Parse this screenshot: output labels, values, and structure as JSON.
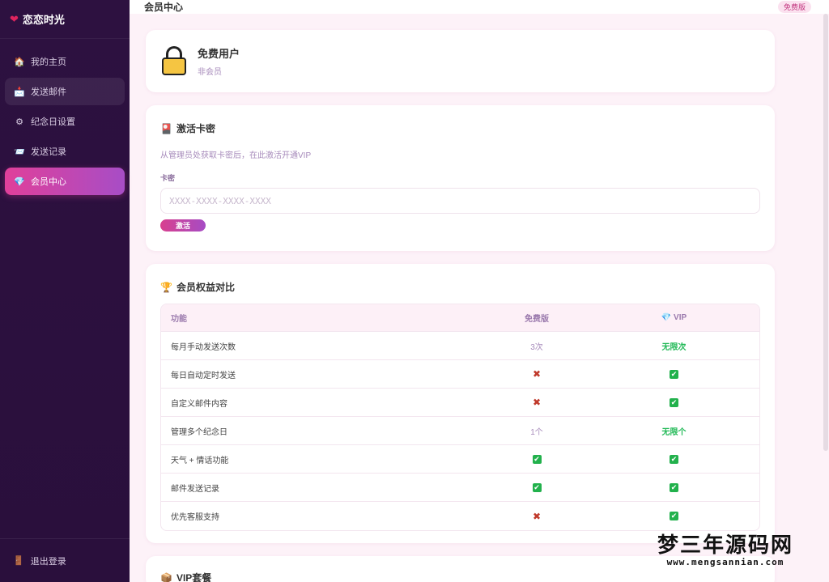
{
  "app": {
    "brand": "恋恋时光"
  },
  "sidebar": {
    "items": [
      {
        "label": "我的主页",
        "icon": "home-icon"
      },
      {
        "label": "发送邮件",
        "icon": "mail-icon"
      },
      {
        "label": "纪念日设置",
        "icon": "gear-icon"
      },
      {
        "label": "发送记录",
        "icon": "record-icon"
      },
      {
        "label": "会员中心",
        "icon": "diamond-icon"
      }
    ],
    "logout": "退出登录"
  },
  "header": {
    "title": "会员中心",
    "badge": "免费版"
  },
  "user": {
    "name": "免费用户",
    "status": "非会员"
  },
  "activate": {
    "title": "激活卡密",
    "hint": "从管理员处获取卡密后，在此激活开通VIP",
    "field_label": "卡密",
    "placeholder": "XXXX-XXXX-XXXX-XXXX",
    "button": "激活"
  },
  "compare": {
    "title": "会员权益对比",
    "headers": [
      "功能",
      "免费版",
      "VIP"
    ],
    "rows": [
      {
        "feature": "每月手动发送次数",
        "free": "3次",
        "vip": "无限次"
      },
      {
        "feature": "每日自动定时发送",
        "free": "✖",
        "vip": "✔"
      },
      {
        "feature": "自定义邮件内容",
        "free": "✖",
        "vip": "✔"
      },
      {
        "feature": "管理多个纪念日",
        "free": "1个",
        "vip": "无限个"
      },
      {
        "feature": "天气 + 情话功能",
        "free": "✔",
        "vip": "✔"
      },
      {
        "feature": "邮件发送记录",
        "free": "✔",
        "vip": "✔"
      },
      {
        "feature": "优先客服支持",
        "free": "✖",
        "vip": "✔"
      }
    ]
  },
  "vip": {
    "title": "VIP套餐"
  },
  "watermark": {
    "main": "梦三年源码网",
    "sub": "www.mengsannian.com"
  },
  "colors": {
    "accent": "#e0409a",
    "sidebar": "#2d1140",
    "success": "#22b14c"
  }
}
